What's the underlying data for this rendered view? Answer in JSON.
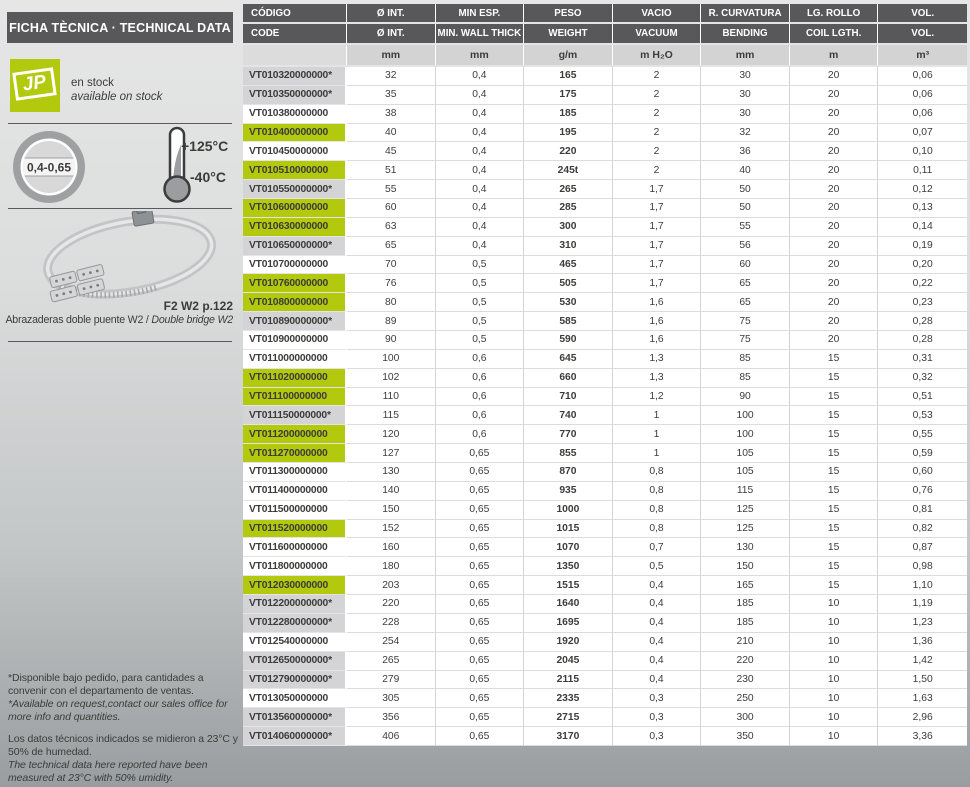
{
  "colors": {
    "accent_green": "#b2c90e",
    "header_dark": "#58585a",
    "row_gray": "#d4d4d6",
    "unit_gray": "#d3d3d4",
    "text_dark": "#3c3c3b"
  },
  "sidebar": {
    "title": "FICHA TÈCNICA · TECHNICAL DATA",
    "logo_text": "JP",
    "stock_es": "en stock",
    "stock_en": "available on stock",
    "thickness_range": "0,4-0,65",
    "temp_max": "+125°C",
    "temp_min": "-40°C",
    "product_ref": "F2 W2 p.122",
    "product_caption_es": "Abrazaderas doble puente W2",
    "product_caption_sep": " / ",
    "product_caption_en": "Double bridge W2",
    "footnote_request_es": "*Disponible bajo pedido, para cantidades a convenir con el departamento de ventas.",
    "footnote_request_en": "*Available on request,contact our sales office for more info and quantities.",
    "footnote_measure_es": "Los datos técnicos indicados se midieron a 23°C y 50% de humedad.",
    "footnote_measure_en": "The technical data here reported have been measured at 23°C with 50% umidity."
  },
  "table": {
    "headers_row1": [
      "CÓDIGO",
      "Ø INT.",
      "MIN ESP.",
      "PESO",
      "VACIO",
      "R. CURVATURA",
      "LG. ROLLO",
      "VOL."
    ],
    "headers_row2": [
      "CODE",
      "Ø INT.",
      "MIN. WALL THICK",
      "WEIGHT",
      "VACUUM",
      "BENDING",
      "COIL LGTH.",
      "VOL."
    ],
    "units": [
      "",
      "mm",
      "mm",
      "g/m",
      "m H₂O",
      "mm",
      "m",
      "m³"
    ],
    "rows": [
      {
        "code": "VT010320000000*",
        "bg": "gray",
        "values": [
          "32",
          "0,4",
          "165",
          "2",
          "30",
          "20",
          "0,06"
        ]
      },
      {
        "code": "VT010350000000*",
        "bg": "gray",
        "values": [
          "35",
          "0,4",
          "175",
          "2",
          "30",
          "20",
          "0,06"
        ]
      },
      {
        "code": "VT010380000000",
        "bg": "white",
        "values": [
          "38",
          "0,4",
          "185",
          "2",
          "30",
          "20",
          "0,06"
        ]
      },
      {
        "code": "VT010400000000",
        "bg": "green",
        "values": [
          "40",
          "0,4",
          "195",
          "2",
          "32",
          "20",
          "0,07"
        ]
      },
      {
        "code": "VT010450000000",
        "bg": "white",
        "values": [
          "45",
          "0,4",
          "220",
          "2",
          "36",
          "20",
          "0,10"
        ]
      },
      {
        "code": "VT010510000000",
        "bg": "green",
        "values": [
          "51",
          "0,4",
          "245t",
          "2",
          "40",
          "20",
          "0,11"
        ]
      },
      {
        "code": "VT010550000000*",
        "bg": "gray",
        "values": [
          "55",
          "0,4",
          "265",
          "1,7",
          "50",
          "20",
          "0,12"
        ]
      },
      {
        "code": "VT010600000000",
        "bg": "green",
        "values": [
          "60",
          "0,4",
          "285",
          "1,7",
          "50",
          "20",
          "0,13"
        ]
      },
      {
        "code": "VT010630000000",
        "bg": "green",
        "values": [
          "63",
          "0,4",
          "300",
          "1,7",
          "55",
          "20",
          "0,14"
        ]
      },
      {
        "code": "VT010650000000*",
        "bg": "gray",
        "values": [
          "65",
          "0,4",
          "310",
          "1,7",
          "56",
          "20",
          "0,19"
        ]
      },
      {
        "code": "VT010700000000",
        "bg": "white",
        "values": [
          "70",
          "0,5",
          "465",
          "1,7",
          "60",
          "20",
          "0,20"
        ]
      },
      {
        "code": "VT010760000000",
        "bg": "green",
        "values": [
          "76",
          "0,5",
          "505",
          "1,7",
          "65",
          "20",
          "0,22"
        ]
      },
      {
        "code": "VT010800000000",
        "bg": "green",
        "values": [
          "80",
          "0,5",
          "530",
          "1,6",
          "65",
          "20",
          "0,23"
        ]
      },
      {
        "code": "VT010890000000*",
        "bg": "gray",
        "values": [
          "89",
          "0,5",
          "585",
          "1,6",
          "75",
          "20",
          "0,28"
        ]
      },
      {
        "code": "VT010900000000",
        "bg": "white",
        "values": [
          "90",
          "0,5",
          "590",
          "1,6",
          "75",
          "20",
          "0,28"
        ]
      },
      {
        "code": "VT011000000000",
        "bg": "white",
        "values": [
          "100",
          "0,6",
          "645",
          "1,3",
          "85",
          "15",
          "0,31"
        ]
      },
      {
        "code": "VT011020000000",
        "bg": "green",
        "values": [
          "102",
          "0,6",
          "660",
          "1,3",
          "85",
          "15",
          "0,32"
        ]
      },
      {
        "code": "VT011100000000",
        "bg": "green",
        "values": [
          "110",
          "0,6",
          "710",
          "1,2",
          "90",
          "15",
          "0,51"
        ]
      },
      {
        "code": "VT011150000000*",
        "bg": "gray",
        "values": [
          "115",
          "0,6",
          "740",
          "1",
          "100",
          "15",
          "0,53"
        ]
      },
      {
        "code": "VT011200000000",
        "bg": "green",
        "values": [
          "120",
          "0,6",
          "770",
          "1",
          "100",
          "15",
          "0,55"
        ]
      },
      {
        "code": "VT011270000000",
        "bg": "green",
        "values": [
          "127",
          "0,65",
          "855",
          "1",
          "105",
          "15",
          "0,59"
        ]
      },
      {
        "code": "VT011300000000",
        "bg": "white",
        "values": [
          "130",
          "0,65",
          "870",
          "0,8",
          "105",
          "15",
          "0,60"
        ]
      },
      {
        "code": "VT011400000000",
        "bg": "white",
        "values": [
          "140",
          "0,65",
          "935",
          "0,8",
          "115",
          "15",
          "0,76"
        ]
      },
      {
        "code": "VT011500000000",
        "bg": "white",
        "values": [
          "150",
          "0,65",
          "1000",
          "0,8",
          "125",
          "15",
          "0,81"
        ]
      },
      {
        "code": "VT011520000000",
        "bg": "green",
        "values": [
          "152",
          "0,65",
          "1015",
          "0,8",
          "125",
          "15",
          "0,82"
        ]
      },
      {
        "code": "VT011600000000",
        "bg": "white",
        "values": [
          "160",
          "0,65",
          "1070",
          "0,7",
          "130",
          "15",
          "0,87"
        ]
      },
      {
        "code": "VT011800000000",
        "bg": "white",
        "values": [
          "180",
          "0,65",
          "1350",
          "0,5",
          "150",
          "15",
          "0,98"
        ]
      },
      {
        "code": "VT012030000000",
        "bg": "green",
        "values": [
          "203",
          "0,65",
          "1515",
          "0,4",
          "165",
          "15",
          "1,10"
        ]
      },
      {
        "code": "VT012200000000*",
        "bg": "gray",
        "values": [
          "220",
          "0,65",
          "1640",
          "0,4",
          "185",
          "10",
          "1,19"
        ]
      },
      {
        "code": "VT012280000000*",
        "bg": "gray",
        "values": [
          "228",
          "0,65",
          "1695",
          "0,4",
          "185",
          "10",
          "1,23"
        ]
      },
      {
        "code": "VT012540000000",
        "bg": "white",
        "values": [
          "254",
          "0,65",
          "1920",
          "0,4",
          "210",
          "10",
          "1,36"
        ]
      },
      {
        "code": "VT012650000000*",
        "bg": "gray",
        "values": [
          "265",
          "0,65",
          "2045",
          "0,4",
          "220",
          "10",
          "1,42"
        ]
      },
      {
        "code": "VT012790000000*",
        "bg": "gray",
        "values": [
          "279",
          "0,65",
          "2115",
          "0,4",
          "230",
          "10",
          "1,50"
        ]
      },
      {
        "code": "VT013050000000",
        "bg": "white",
        "values": [
          "305",
          "0,65",
          "2335",
          "0,3",
          "250",
          "10",
          "1,63"
        ]
      },
      {
        "code": "VT013560000000*",
        "bg": "gray",
        "values": [
          "356",
          "0,65",
          "2715",
          "0,3",
          "300",
          "10",
          "2,96"
        ]
      },
      {
        "code": "VT014060000000*",
        "bg": "gray",
        "values": [
          "406",
          "0,65",
          "3170",
          "0,3",
          "350",
          "10",
          "3,36"
        ]
      }
    ]
  }
}
